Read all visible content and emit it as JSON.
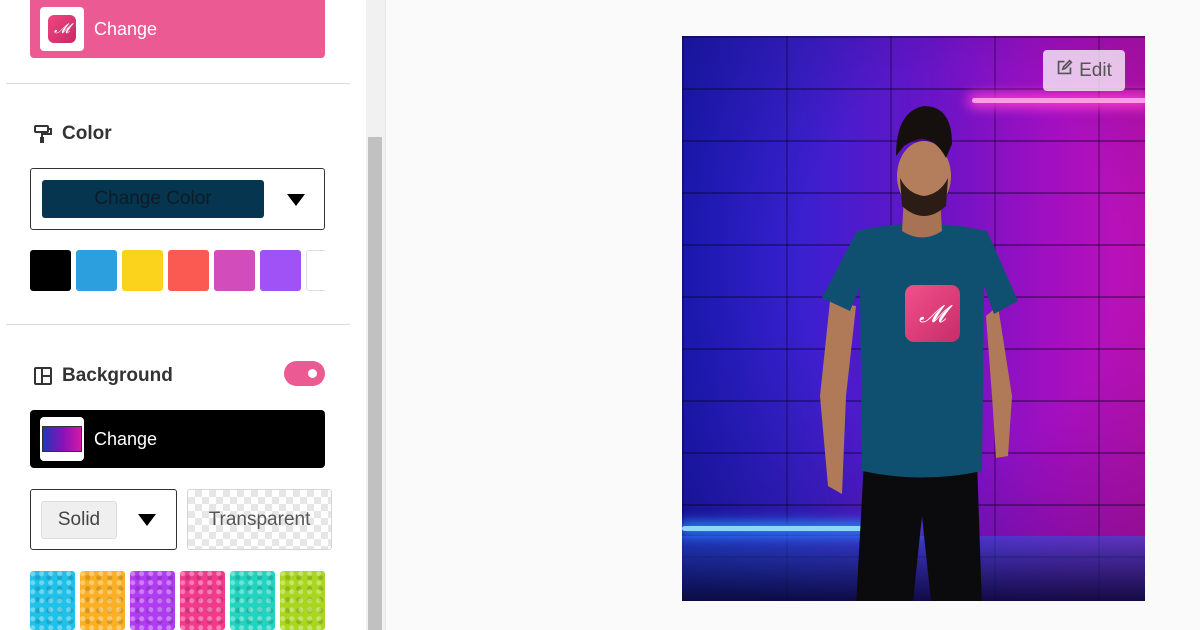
{
  "design": {
    "change_label": "Change"
  },
  "color": {
    "title": "Color",
    "change_color_label": "Change Color",
    "selected_color": "#05354f",
    "swatches": [
      "#000000",
      "#2c9fdf",
      "#fbd31c",
      "#fa5a52",
      "#d24cbc",
      "#a152f7",
      "#ffffff"
    ]
  },
  "background": {
    "title": "Background",
    "toggle_on": true,
    "change_label": "Change",
    "type_value": "Solid",
    "transparent_label": "Transparent",
    "patterns": [
      "#1fc1e9",
      "#fbb024",
      "#b03cf2",
      "#f23a8c",
      "#22d4bf",
      "#a9d61e"
    ]
  },
  "preview": {
    "edit_label": "Edit",
    "tshirt_color": "#0f5070",
    "logo_glyph": "𝓜"
  },
  "accent": "#ec5a93"
}
